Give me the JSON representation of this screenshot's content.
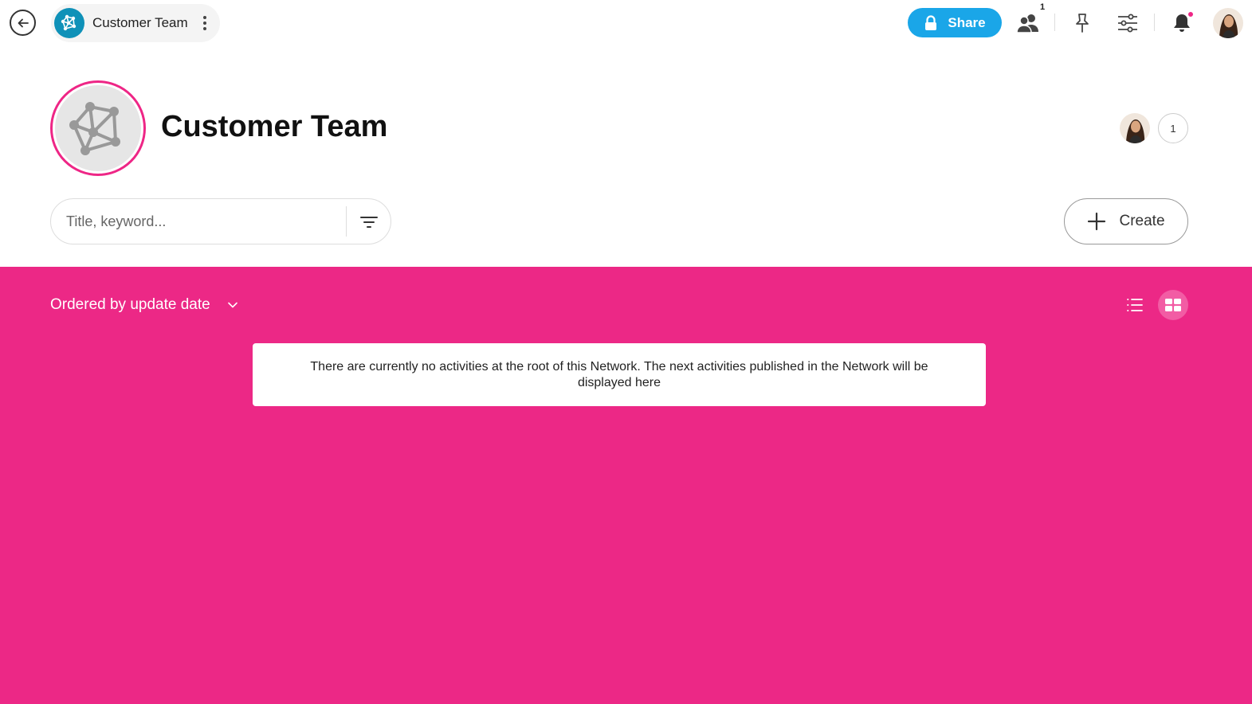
{
  "topbar": {
    "breadcrumb_title": "Customer Team",
    "share_label": "Share",
    "members_badge": "1",
    "brand_color": "#0f91b8",
    "share_color": "#1aa6e8"
  },
  "header": {
    "title": "Customer Team",
    "member_count": "1",
    "accent_color": "#ee2686"
  },
  "search": {
    "placeholder": "Title, keyword...",
    "value": ""
  },
  "create_label": "Create",
  "content": {
    "order_label": "Ordered by update date",
    "empty_message": "There are currently no activities at the root of this Network. The next activities published in the Network will be displayed here",
    "background_color": "#ec2886"
  }
}
